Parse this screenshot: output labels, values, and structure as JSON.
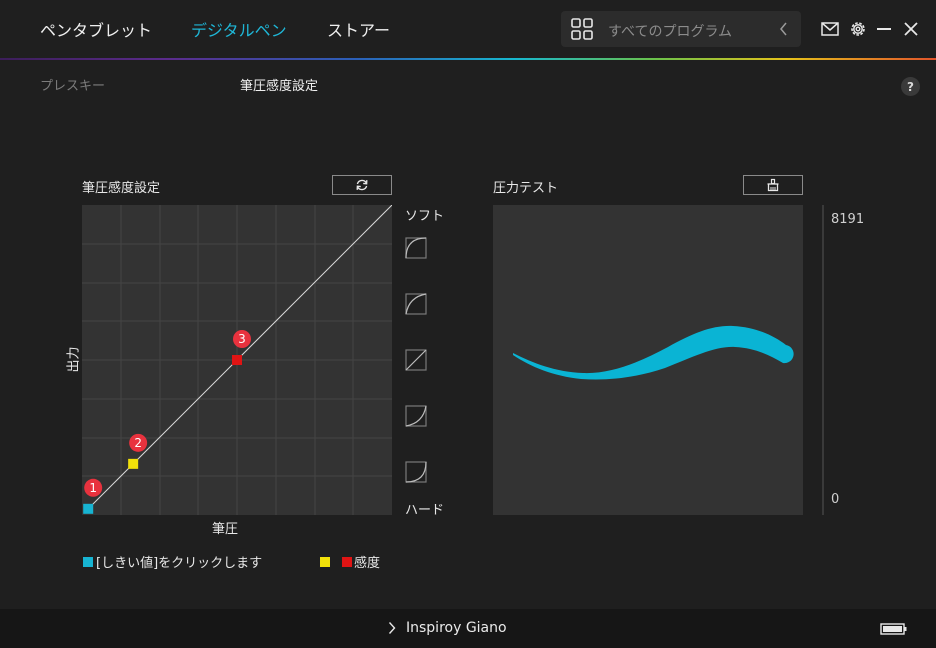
{
  "header": {
    "tabs": [
      {
        "label": "ペンタブレット"
      },
      {
        "label": "デジタルペン",
        "active": true
      },
      {
        "label": "ストアー"
      }
    ],
    "search": {
      "placeholder": "すべてのプログラム",
      "icon": "grid-icon",
      "chevron": "chevron-left-icon"
    },
    "icons": [
      "mail-icon",
      "gear-icon",
      "minimize-icon",
      "close-icon"
    ]
  },
  "subtabs": {
    "press_key": "プレスキー",
    "pressure_settings": "筆圧感度設定",
    "help": "?"
  },
  "curve_panel": {
    "title": "筆圧感度設定",
    "reset_icon": "refresh-icon",
    "y_label": "出力",
    "x_label": "筆圧",
    "soft_label": "ソフト",
    "hard_label": "ハード",
    "points": [
      {
        "label": "1",
        "x": 0.02,
        "y": 0.02,
        "color": "#17b4d2"
      },
      {
        "label": "2",
        "x": 0.165,
        "y": 0.165,
        "color": "#f2e10a"
      },
      {
        "label": "3",
        "x": 0.5,
        "y": 0.5,
        "color": "#e01414"
      }
    ],
    "presets": [
      "curve-soft-2-icon",
      "curve-soft-1-icon",
      "curve-linear-icon",
      "curve-hard-1-icon",
      "curve-hard-2-icon"
    ]
  },
  "legend": {
    "threshold_text": "[しきい値]をクリックします",
    "sensitivity_text": "感度",
    "threshold_color": "#17b4d2",
    "sens_color_1": "#f2e10a",
    "sens_color_2": "#e01414"
  },
  "pressure_test": {
    "title": "圧力テスト",
    "clear_icon": "clear-icon",
    "max": "8191",
    "min": "0",
    "stroke_color": "#0ab4d4"
  },
  "footer": {
    "device_name": "Inspiroy Giano",
    "battery_icon": "battery-icon"
  },
  "colors": {
    "accent": "#1fb6d6",
    "background": "#1f1f1f"
  }
}
